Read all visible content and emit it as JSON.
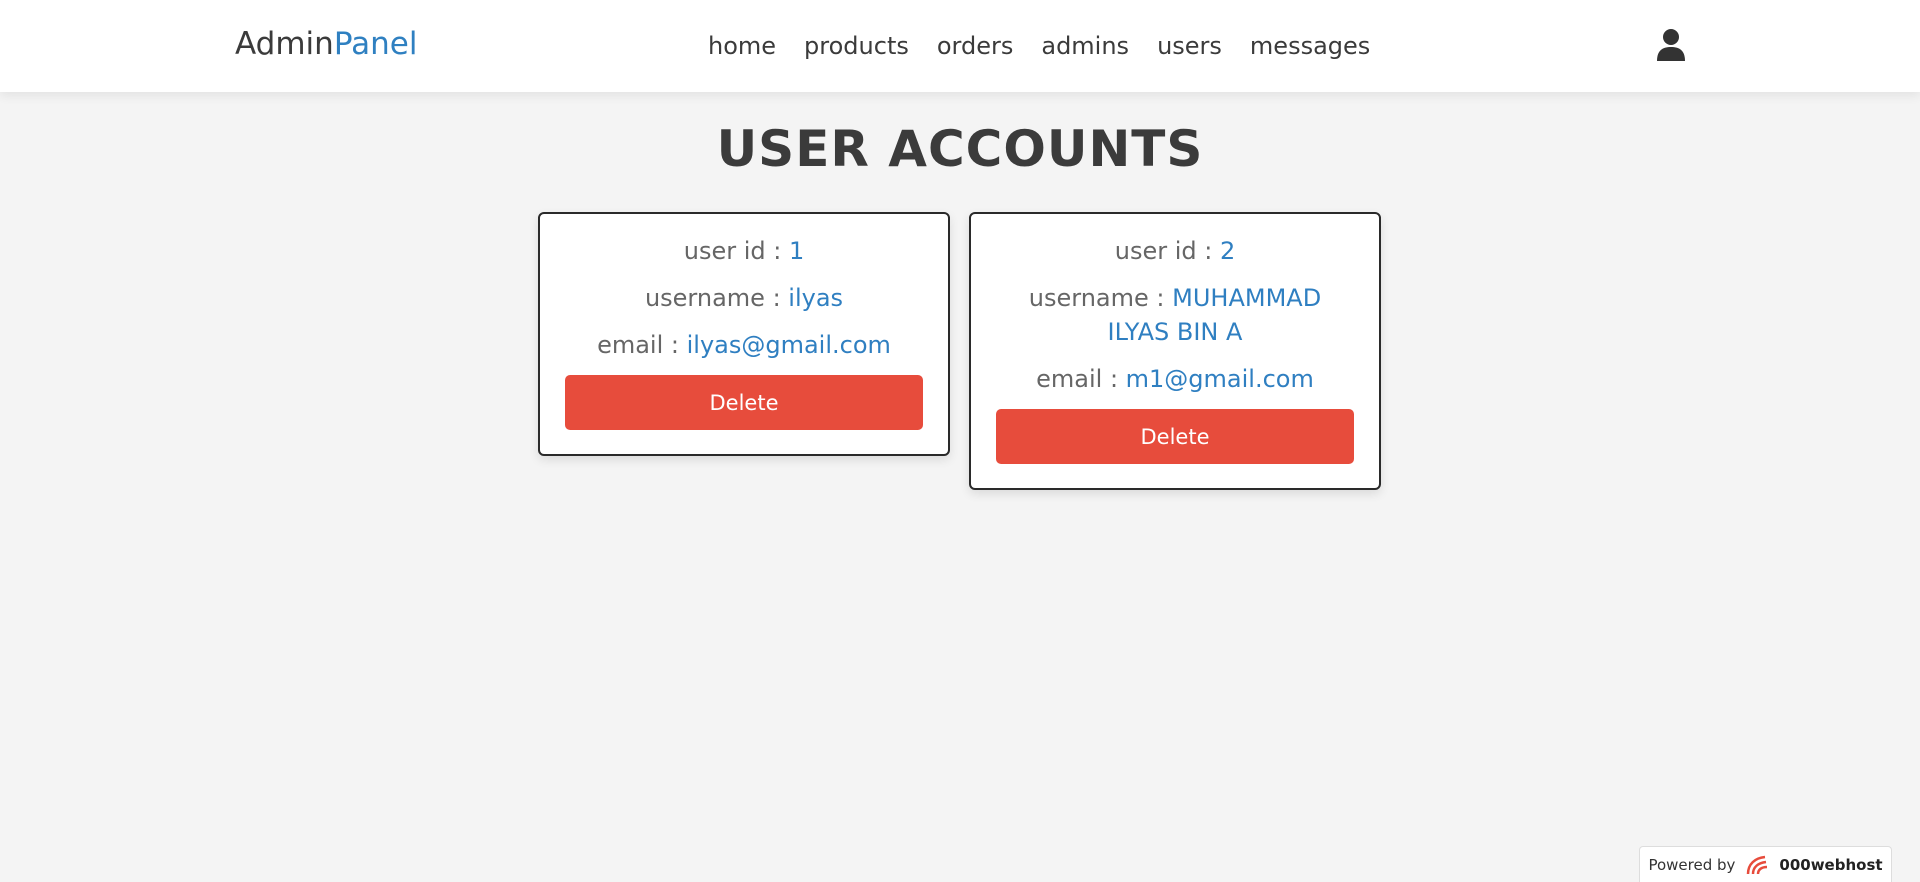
{
  "header": {
    "logo_main": "Admin",
    "logo_accent": "Panel",
    "nav": [
      "home",
      "products",
      "orders",
      "admins",
      "users",
      "messages"
    ]
  },
  "page": {
    "title": "USER ACCOUNTS"
  },
  "users": [
    {
      "id_label": "user id : ",
      "id": "1",
      "username_label": "username : ",
      "username": "ilyas",
      "email_label": "email : ",
      "email": "ilyas@gmail.com",
      "delete_label": "Delete"
    },
    {
      "id_label": "user id : ",
      "id": "2",
      "username_label": "username : ",
      "username": "MUHAMMAD ILYAS BIN A",
      "email_label": "email : ",
      "email": "m1@gmail.com",
      "delete_label": "Delete"
    }
  ],
  "footer": {
    "powered_label": "Powered by",
    "brand": "000webhost"
  },
  "colors": {
    "accent": "#2f80c1",
    "danger": "#e74c3c",
    "background": "#f4f4f4"
  },
  "icons": {
    "profile": "user-icon",
    "brand": "webhost-logo-icon"
  }
}
